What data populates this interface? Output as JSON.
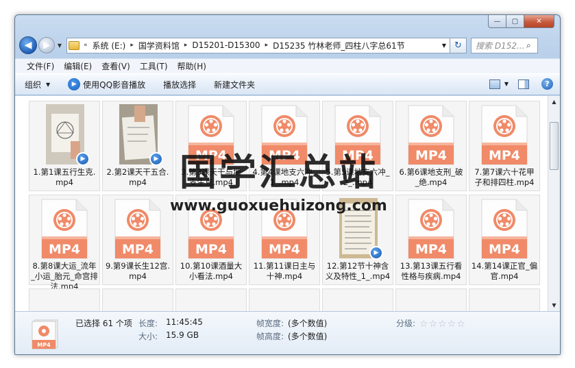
{
  "window": {
    "caption": {
      "minimize": "—",
      "maximize": "▢",
      "close": "✕"
    }
  },
  "nav": {
    "back_glyph": "◀",
    "forward_glyph": "▶",
    "history_glyph": "▼"
  },
  "address": {
    "prefix": "«",
    "crumbs": [
      "系统 (E:)",
      "国学资料馆",
      "D15201-D15300",
      "D15235 竹林老师_四柱八字总61节"
    ],
    "separator": "▸",
    "drop_glyph": "▼",
    "refresh_glyph": "↻"
  },
  "search": {
    "placeholder": "搜索 D152...",
    "icon": "search-icon"
  },
  "menubar": [
    "文件(F)",
    "编辑(E)",
    "查看(V)",
    "工具(T)",
    "帮助(H)"
  ],
  "toolbar": {
    "organize": "组织",
    "qq_play": "使用QQ影音播放",
    "playlist": "播放选择",
    "new_folder": "新建文件夹",
    "caret": "▼",
    "help": "?"
  },
  "files": [
    {
      "name": "1.第1课五行生克.mp4",
      "thumb": "photo-diagram",
      "badge": true
    },
    {
      "name": "2.第2课天干五合.mp4",
      "thumb": "photo-hand",
      "badge": true
    },
    {
      "name": "3.第3课天干与地支生克.mp4",
      "thumb": "mp4"
    },
    {
      "name": "4.第4课地支六冲_1_.mp4",
      "thumb": "mp4"
    },
    {
      "name": "5.第5课地支六冲_2_.mp4",
      "thumb": "mp4"
    },
    {
      "name": "6.第6课地支刑_破_绝.mp4",
      "thumb": "mp4"
    },
    {
      "name": "7.第7课六十花甲子和排四柱.mp4",
      "thumb": "mp4"
    },
    {
      "name": "8.第8课大运_流年_小运_胎元_命宫排法.mp4",
      "thumb": "mp4"
    },
    {
      "name": "9.第9课长生12宫.mp4",
      "thumb": "mp4"
    },
    {
      "name": "10.第10课酒量大小看法.mp4",
      "thumb": "mp4"
    },
    {
      "name": "11.第11课日主与十神.mp4",
      "thumb": "mp4"
    },
    {
      "name": "12.第12节十神含义及特性_1_.mp4",
      "thumb": "photo-notes",
      "badge": true
    },
    {
      "name": "13.第13课五行看性格与疾病.mp4",
      "thumb": "mp4"
    },
    {
      "name": "14.第14课正官_偏官.mp4",
      "thumb": "mp4"
    }
  ],
  "mp4_label": "MP4",
  "scrollbar": {
    "up": "▲",
    "down": "▼"
  },
  "details": {
    "selected": "已选择 61 个项",
    "length_label": "长度:",
    "length_value": "11:45:45",
    "size_label": "大小:",
    "size_value": "15.9 GB",
    "frame_width_label": "帧宽度:",
    "frame_width_value": "(多个数值)",
    "frame_height_label": "帧高度:",
    "frame_height_value": "(多个数值)",
    "rating_label": "分级:",
    "rating_stars": 0
  },
  "watermark": {
    "cn": "国学汇总站",
    "url": "www.guoxuehuizong.com"
  },
  "colors": {
    "mp4_orange": "#f08a68",
    "mp4_orange_light": "#f6b59e",
    "title_blue": "#c9dcf0"
  }
}
